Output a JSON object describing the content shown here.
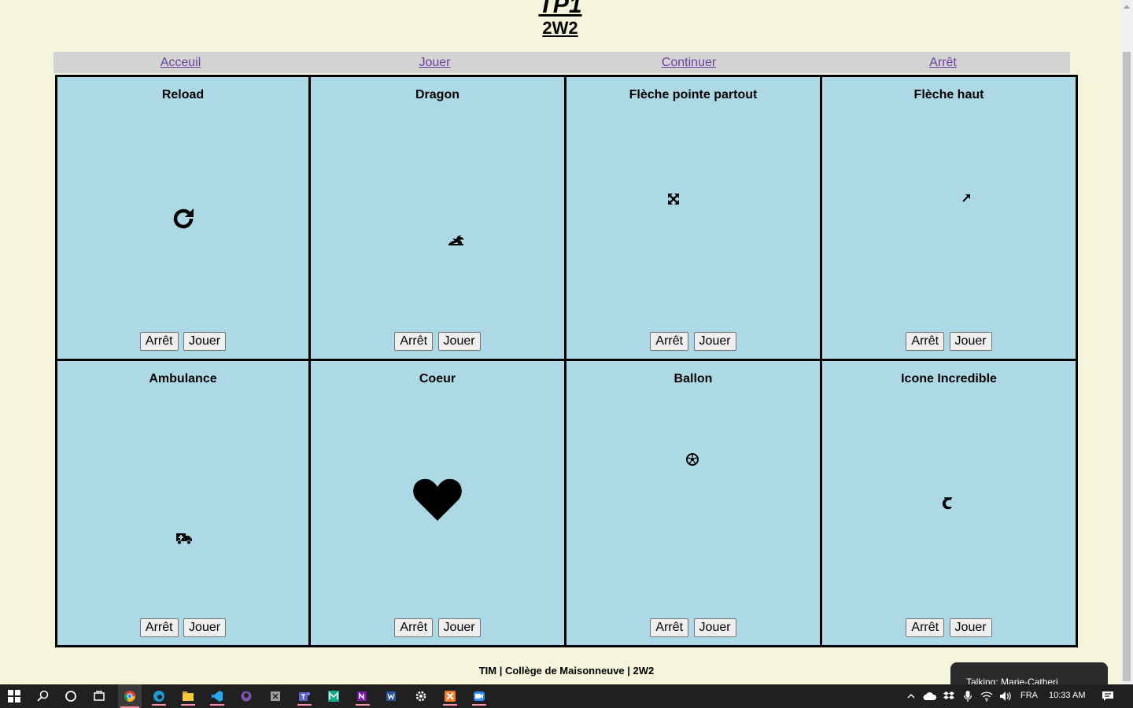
{
  "header": {
    "title": "TP1",
    "subtitle": "2W2"
  },
  "nav": [
    "Acceuil",
    "Jouer",
    "Continuer",
    "Arrêt"
  ],
  "cards": [
    {
      "title": "Reload",
      "icon": "reload-icon",
      "stop": "Arrêt",
      "play": "Jouer"
    },
    {
      "title": "Dragon",
      "icon": "dragon-icon",
      "stop": "Arrêt",
      "play": "Jouer"
    },
    {
      "title": "Flèche pointe partout",
      "icon": "expand-arrows-icon",
      "stop": "Arrêt",
      "play": "Jouer"
    },
    {
      "title": "Flèche haut",
      "icon": "arrow-up-right-icon",
      "stop": "Arrêt",
      "play": "Jouer"
    },
    {
      "title": "Ambulance",
      "icon": "ambulance-icon",
      "stop": "Arrêt",
      "play": "Jouer"
    },
    {
      "title": "Coeur",
      "icon": "heart-icon",
      "stop": "Arrêt",
      "play": "Jouer"
    },
    {
      "title": "Ballon",
      "icon": "soccer-ball-icon",
      "stop": "Arrêt",
      "play": "Jouer"
    },
    {
      "title": "Icone Incredible",
      "icon": "incredible-icon",
      "stop": "Arrêt",
      "play": "Jouer"
    }
  ],
  "footer": {
    "text": "TIM | Collège de Maisonneuve | 2W2"
  },
  "notification": {
    "text": "Talking: Marie-Catheri"
  },
  "taskbar": {
    "language": "FRA",
    "time": "10:33 AM"
  },
  "colors": {
    "page_bg": "#f5f5dc",
    "card_bg": "#add8e6",
    "nav_bg": "#d3d3d3",
    "link": "#6b3fa0"
  }
}
